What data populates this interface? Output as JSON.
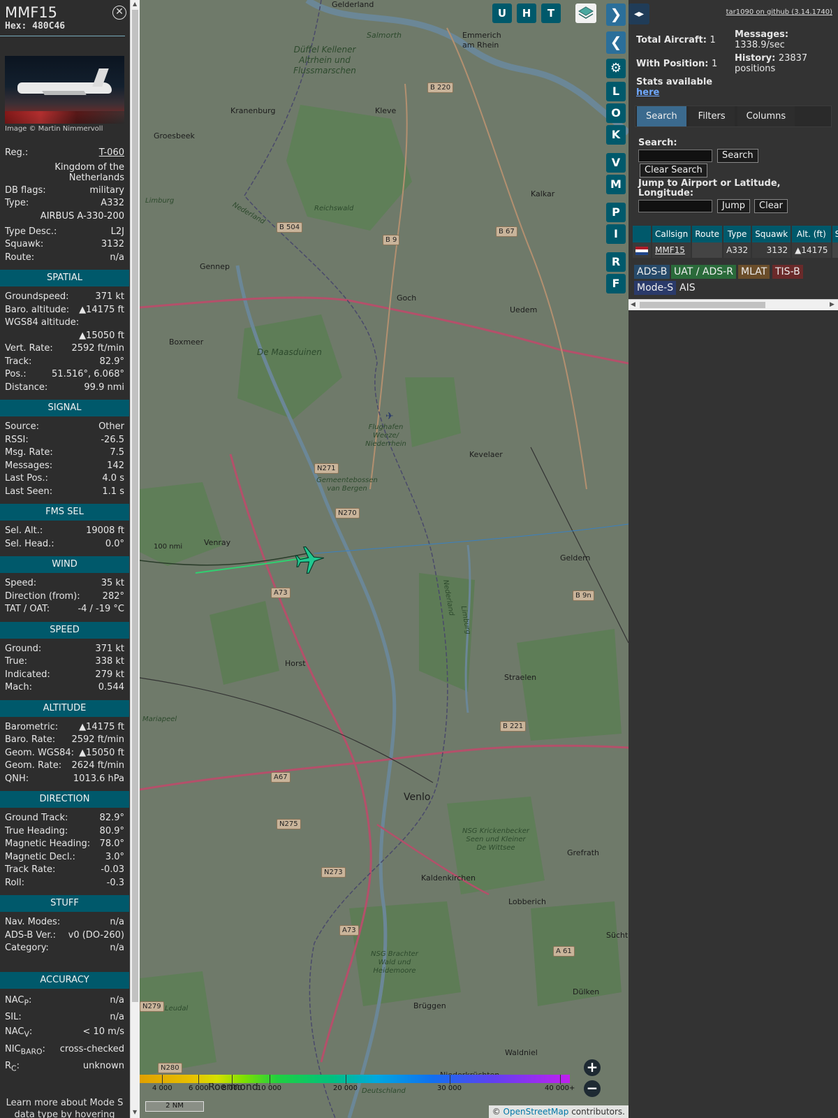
{
  "aircraft": {
    "callsign": "MMF15",
    "hex_label": "Hex:",
    "hex": "480C46",
    "photo_credit": "Image © Martin Nimmervoll",
    "reg_label": "Reg.:",
    "reg": "T-060",
    "country": "Kingdom of the Netherlands",
    "rows_top": [
      {
        "k": "DB flags:",
        "v": "military"
      },
      {
        "k": "Type:",
        "v": "A332"
      }
    ],
    "type_full": "AIRBUS A-330-200",
    "rows_mid": [
      {
        "k": "Type Desc.:",
        "v": "L2J"
      },
      {
        "k": "Squawk:",
        "v": "3132"
      },
      {
        "k": "Route:",
        "v": "n/a"
      }
    ]
  },
  "sections": {
    "spatial": "SPATIAL",
    "signal": "SIGNAL",
    "fms": "FMS SEL",
    "wind": "WIND",
    "speed": "SPEED",
    "altitude": "ALTITUDE",
    "direction": "DIRECTION",
    "stuff": "STUFF",
    "accuracy": "ACCURACY"
  },
  "spatial": {
    "groundspeed_k": "Groundspeed:",
    "groundspeed": "371 kt",
    "baro_k": "Baro. altitude:",
    "baro": "▲14175 ft",
    "wgs_k": "WGS84 altitude:",
    "wgs": "▲15050 ft",
    "vrate_k": "Vert. Rate:",
    "vrate": "2592 ft/min",
    "track_k": "Track:",
    "track": "82.9°",
    "pos_k": "Pos.:",
    "pos": "51.516°, 6.068°",
    "dist_k": "Distance:",
    "dist": "99.9 nmi"
  },
  "signal": [
    {
      "k": "Source:",
      "v": "Other"
    },
    {
      "k": "RSSI:",
      "v": "-26.5"
    },
    {
      "k": "Msg. Rate:",
      "v": "7.5"
    },
    {
      "k": "Messages:",
      "v": "142"
    },
    {
      "k": "Last Pos.:",
      "v": "4.0 s"
    },
    {
      "k": "Last Seen:",
      "v": "1.1 s"
    }
  ],
  "fms": [
    {
      "k": "Sel. Alt.:",
      "v": "19008 ft"
    },
    {
      "k": "Sel. Head.:",
      "v": "0.0°"
    }
  ],
  "wind": [
    {
      "k": "Speed:",
      "v": "35 kt"
    },
    {
      "k": "Direction (from):",
      "v": "282°"
    },
    {
      "k": "TAT / OAT:",
      "v": "-4 / -19 °C"
    }
  ],
  "speed": [
    {
      "k": "Ground:",
      "v": "371 kt"
    },
    {
      "k": "True:",
      "v": "338 kt"
    },
    {
      "k": "Indicated:",
      "v": "279 kt"
    },
    {
      "k": "Mach:",
      "v": "0.544"
    }
  ],
  "altitude": [
    {
      "k": "Barometric:",
      "v": "▲14175 ft"
    },
    {
      "k": "Baro. Rate:",
      "v": "2592 ft/min"
    },
    {
      "k": "Geom. WGS84:",
      "v": "▲15050 ft"
    },
    {
      "k": "Geom. Rate:",
      "v": "2624 ft/min"
    },
    {
      "k": "QNH:",
      "v": "1013.6 hPa"
    }
  ],
  "direction": [
    {
      "k": "Ground Track:",
      "v": "82.9°"
    },
    {
      "k": "True Heading:",
      "v": "80.9°"
    },
    {
      "k": "Magnetic Heading:",
      "v": "78.0°"
    },
    {
      "k": "Magnetic Decl.:",
      "v": "3.0°"
    },
    {
      "k": "Track Rate:",
      "v": "-0.03"
    },
    {
      "k": "Roll:",
      "v": "-0.3"
    }
  ],
  "stuff": [
    {
      "k": "Nav. Modes:",
      "v": "n/a"
    },
    {
      "k": "ADS-B Ver.:",
      "v": "v0 (DO-260)"
    },
    {
      "k": "Category:",
      "v": "n/a"
    }
  ],
  "accuracy": {
    "nacp_base": "NAC",
    "nacp_sub": "P",
    "nacp": "n/a",
    "sil_k": "SIL:",
    "sil": "n/a",
    "nacv_base": "NAC",
    "nacv_sub": "V",
    "nacv": "< 10 m/s",
    "nicb_base": "NIC",
    "nicb_sub": "BARO",
    "nicb": "cross-checked",
    "rc_base": "R",
    "rc_sub": "C",
    "rc": "unknown",
    "colon": ":"
  },
  "footer_note": "Learn more about Mode S data type by hovering over each data label.",
  "map": {
    "top_buttons": [
      "U",
      "H",
      "T"
    ],
    "side_buttons": [
      "L",
      "O",
      "K",
      "V",
      "M",
      "P",
      "I",
      "R",
      "F"
    ],
    "range_ring": "100 nmi",
    "places": [
      {
        "t": "Gelderland"
      },
      {
        "t": "Salmorth"
      },
      {
        "t": "Emmerich am Rhein"
      },
      {
        "t": "Düffel Kellener Altrhein und Flussmarschen"
      },
      {
        "t": "Kranenburg"
      },
      {
        "t": "Kleve"
      },
      {
        "t": "Groesbeek"
      },
      {
        "t": "Kalkar"
      },
      {
        "t": "Reichswald"
      },
      {
        "t": "Limburg"
      },
      {
        "t": "Nederland"
      },
      {
        "t": "Gennep"
      },
      {
        "t": "Goch"
      },
      {
        "t": "Uedem"
      },
      {
        "t": "Boxmeer"
      },
      {
        "t": "De Maasduinen"
      },
      {
        "t": "Flughafen Weeze/ Niederrhein"
      },
      {
        "t": "Kevelaer"
      },
      {
        "t": "Gemeentebossen van Bergen"
      },
      {
        "t": "Venray"
      },
      {
        "t": "Geldern"
      },
      {
        "t": "Horst"
      },
      {
        "t": "Straelen"
      },
      {
        "t": "Mariapeel"
      },
      {
        "t": "Venlo"
      },
      {
        "t": "NSG Krickenbecker Seen und Kleiner De Wittsee"
      },
      {
        "t": "Grefrath"
      },
      {
        "t": "Kaldenkirchen"
      },
      {
        "t": "Lobberich"
      },
      {
        "t": "Süchteln"
      },
      {
        "t": "NSG Brachter Wald und Heidemoore"
      },
      {
        "t": "Dülken"
      },
      {
        "t": "Leudal"
      },
      {
        "t": "Brüggen"
      },
      {
        "t": "Waldniel"
      },
      {
        "t": "Niederkrüchten"
      },
      {
        "t": "Roermond"
      },
      {
        "t": "Deutschland"
      },
      {
        "t": "Limburg"
      },
      {
        "t": "Nederland"
      }
    ],
    "roads": [
      "B 220",
      "B 504",
      "B 9",
      "B 67",
      "N271",
      "N270",
      "A73",
      "B 9n",
      "B 221",
      "A67",
      "N275",
      "N273",
      "A73",
      "A 61",
      "N279",
      "N280"
    ],
    "colorbar_ticks": [
      "4 000",
      "6 000",
      "8 000",
      "10 000",
      "20 000",
      "30 000",
      "40 000+"
    ],
    "scale_box": "2 NM",
    "attribution_prefix": "©",
    "attribution_link": "OpenStreetMap",
    "attribution_suffix": "contributors."
  },
  "sidebar": {
    "github": "tar1090 on github (3.14.1740)",
    "total_label": "Total Aircraft:",
    "total": "1",
    "with_pos_label": "With Position:",
    "with_pos": "1",
    "messages_label": "Messages:",
    "messages": "1338.9/sec",
    "history_label": "History:",
    "history": "23837 positions",
    "stats_label": "Stats available",
    "stats_link": "here",
    "tabs": [
      "Search",
      "Filters",
      "Columns"
    ],
    "search_label": "Search:",
    "search_button": "Search",
    "clear_search_button": "Clear Search",
    "jump_label": "Jump to Airport or Latitude, Longitude:",
    "jump_button": "Jump",
    "clear_button": "Clear",
    "table_headers": [
      "",
      "Callsign",
      "Route",
      "Type",
      "Squawk",
      "Alt. (ft)",
      "Spd"
    ],
    "table_row": {
      "callsign": "MMF15",
      "route": "",
      "type": "A332",
      "squawk": "3132",
      "alt": "▲14175",
      "spd": ""
    },
    "sources": [
      "ADS-B",
      "UAT / ADS-R",
      "MLAT",
      "TIS-B",
      "Mode-S",
      "AIS"
    ],
    "colors": {
      "adsb": "#274a6a",
      "uat": "#2a6a3a",
      "mlat": "#6a4d2a",
      "tisb": "#6a2a2a",
      "modes": "#2a3a6a"
    }
  }
}
